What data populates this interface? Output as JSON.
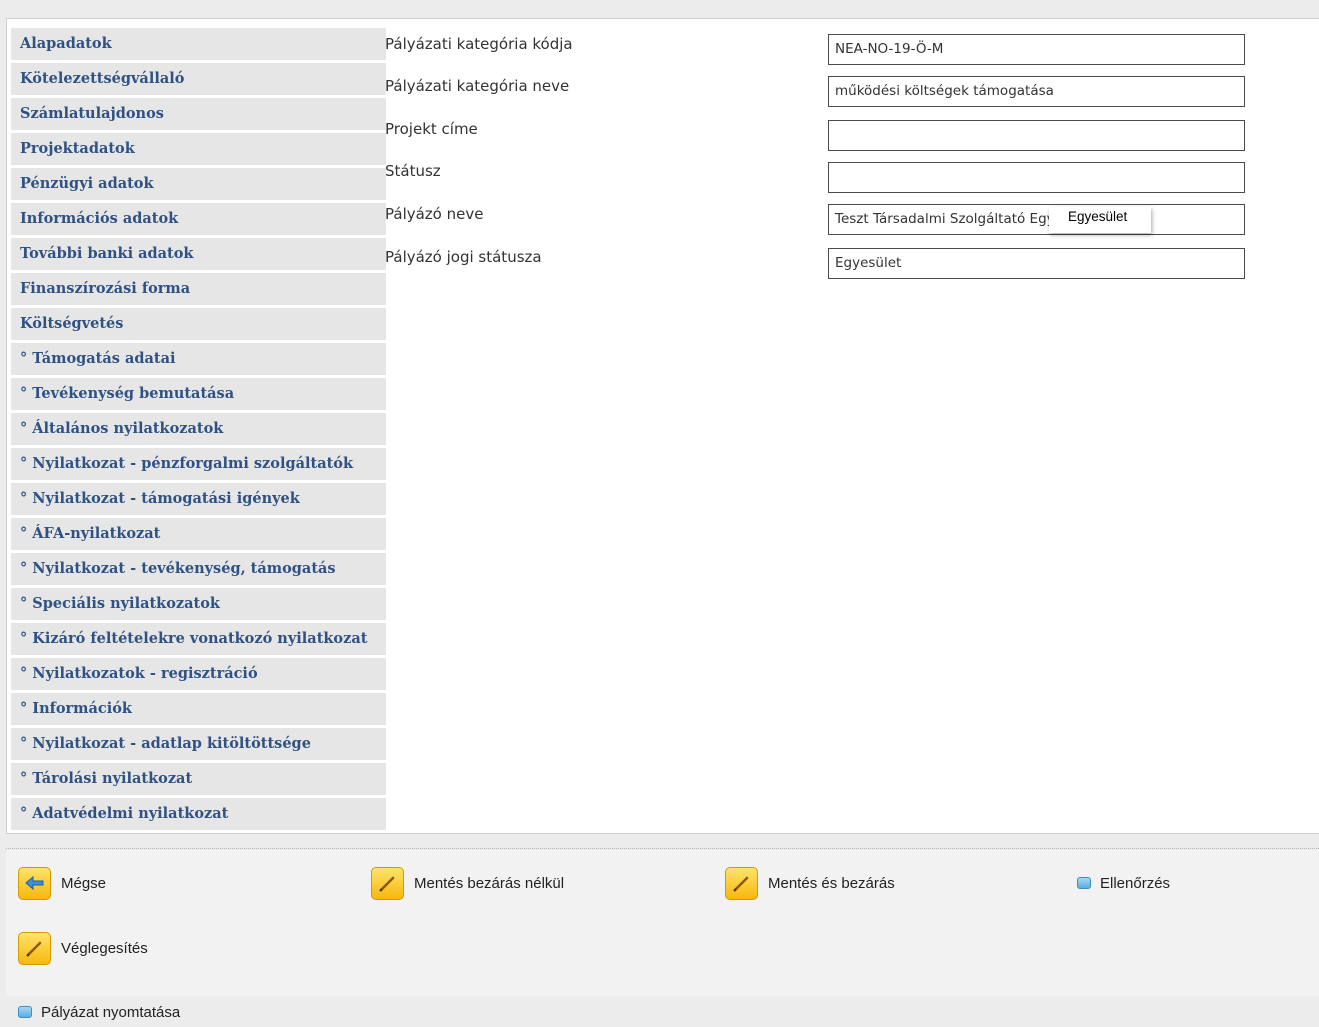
{
  "sidebar": {
    "items": [
      {
        "label": "Alapadatok"
      },
      {
        "label": "Kötelezettségvállaló"
      },
      {
        "label": "Számlatulajdonos"
      },
      {
        "label": "Projektadatok"
      },
      {
        "label": "Pénzügyi adatok"
      },
      {
        "label": "Információs adatok"
      },
      {
        "label": "További banki adatok"
      },
      {
        "label": "Finanszírozási forma"
      },
      {
        "label": "Költségvetés"
      },
      {
        "label": "° Támogatás adatai"
      },
      {
        "label": "° Tevékenység bemutatása"
      },
      {
        "label": "° Általános nyilatkozatok"
      },
      {
        "label": "° Nyilatkozat - pénzforgalmi szolgáltatók"
      },
      {
        "label": "° Nyilatkozat - támogatási igények"
      },
      {
        "label": "° ÁFA-nyilatkozat"
      },
      {
        "label": "° Nyilatkozat - tevékenység, támogatás"
      },
      {
        "label": "° Speciális nyilatkozatok"
      },
      {
        "label": "° Kizáró feltételekre vonatkozó nyilatkozat"
      },
      {
        "label": "° Nyilatkozatok - regisztráció"
      },
      {
        "label": "° Információk"
      },
      {
        "label": "° Nyilatkozat - adatlap kitöltöttsége"
      },
      {
        "label": "° Tárolási nyilatkozat"
      },
      {
        "label": "° Adatvédelmi nyilatkozat"
      }
    ]
  },
  "form": {
    "fields": [
      {
        "label": "Pályázati kategória kódja",
        "value": "NEA-NO-19-Ö-M"
      },
      {
        "label": "Pályázati kategória neve",
        "value": "működési költségek támogatása"
      },
      {
        "label": "Projekt címe",
        "value": ""
      },
      {
        "label": "Státusz",
        "value": ""
      },
      {
        "label": "Pályázó neve",
        "value": "Teszt Társadalmi Szolgáltató Egyesület"
      },
      {
        "label": "Pályázó jogi státusza",
        "value": "Egyesület"
      }
    ]
  },
  "tooltip": {
    "text": "Egyesület"
  },
  "actions": {
    "cancel": {
      "label": "Mégse",
      "icon": "back-arrow-icon"
    },
    "save_no_close": {
      "label": "Mentés bezárás nélkül",
      "icon": "pencil-icon"
    },
    "save_close": {
      "label": "Mentés és bezárás",
      "icon": "pencil-icon"
    },
    "check": {
      "label": "Ellenőrzés",
      "icon": "check-square-icon"
    },
    "finalize": {
      "label": "Véglegesítés",
      "icon": "pencil-icon"
    },
    "print": {
      "label": "Pályázat nyomtatása",
      "icon": "print-square-icon"
    }
  },
  "colors": {
    "sidebar_text": "#2f5183",
    "sidebar_bg": "#e6e6e6",
    "button_yellow": "#f6b80e",
    "icon_blue": "#5aaee0"
  }
}
